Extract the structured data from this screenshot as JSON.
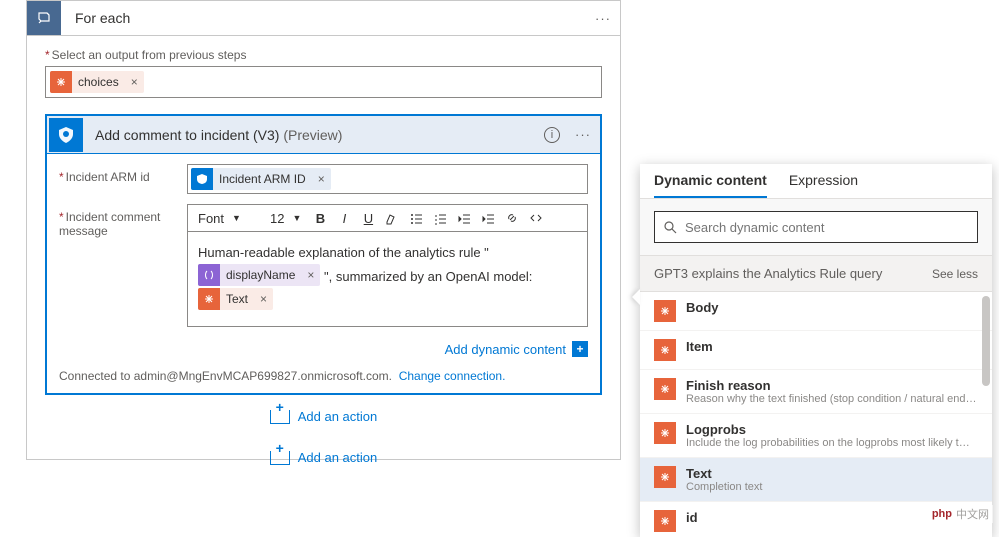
{
  "foreach": {
    "title": "For each",
    "select_label": "Select an output from previous steps",
    "token": {
      "label": "choices",
      "remove": "×"
    }
  },
  "action": {
    "title": "Add comment to incident (V3)",
    "preview": "(Preview)",
    "fields": {
      "armid_label": "Incident ARM id",
      "armid_token": {
        "label": "Incident ARM ID",
        "remove": "×"
      },
      "message_label": "Incident comment message"
    },
    "rte": {
      "font_label": "Font",
      "size_label": "12",
      "body_prefix": "Human-readable explanation of the analytics rule \"",
      "token_displayName": {
        "label": "displayName",
        "remove": "×"
      },
      "body_mid": "\", summarized by an OpenAI model:",
      "token_text": {
        "label": "Text",
        "remove": "×"
      }
    },
    "add_dynamic": "Add dynamic content",
    "connected_prefix": "Connected to admin@MngEnvMCAP699827.onmicrosoft.com.",
    "change_connection": "Change connection."
  },
  "add_action": "Add an action",
  "flyout": {
    "tab_dynamic": "Dynamic content",
    "tab_expression": "Expression",
    "search_placeholder": "Search dynamic content",
    "section_title": "GPT3 explains the Analytics Rule query",
    "see_less": "See less",
    "items": [
      {
        "title": "Body",
        "desc": ""
      },
      {
        "title": "Item",
        "desc": ""
      },
      {
        "title": "Finish reason",
        "desc": "Reason why the text finished (stop condition / natural end…"
      },
      {
        "title": "Logprobs",
        "desc": "Include the log probabilities on the logprobs most likely t…"
      },
      {
        "title": "Text",
        "desc": "Completion text",
        "selected": true
      },
      {
        "title": "id",
        "desc": ""
      }
    ]
  },
  "watermark": "中文网"
}
